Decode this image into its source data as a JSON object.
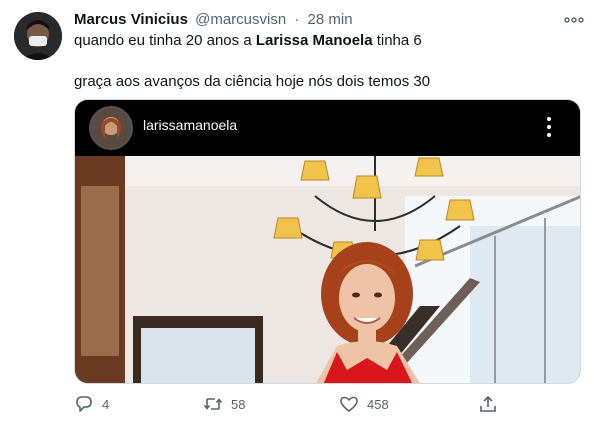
{
  "tweet": {
    "author_name": "Marcus Vinicius",
    "author_handle": "@marcusvisn",
    "separator": "·",
    "time": "28 min",
    "line1_before": "quando eu tinha 20 anos a ",
    "line1_bold": "Larissa Manoela",
    "line1_after": " tinha 6",
    "line2": "graça aos avanços da ciência hoje nós dois temos 30"
  },
  "media": {
    "instagram_username": "larissamanoela"
  },
  "actions": {
    "reply_count": "4",
    "retweet_count": "58",
    "like_count": "458"
  },
  "colors": {
    "text_primary": "#0f1419",
    "text_secondary": "#536471",
    "border": "#cfd9de",
    "dress_red": "#d8161c"
  },
  "icons": [
    "more-options-icon",
    "instagram-menu-icon",
    "reply-icon",
    "retweet-icon",
    "like-icon",
    "share-icon"
  ]
}
